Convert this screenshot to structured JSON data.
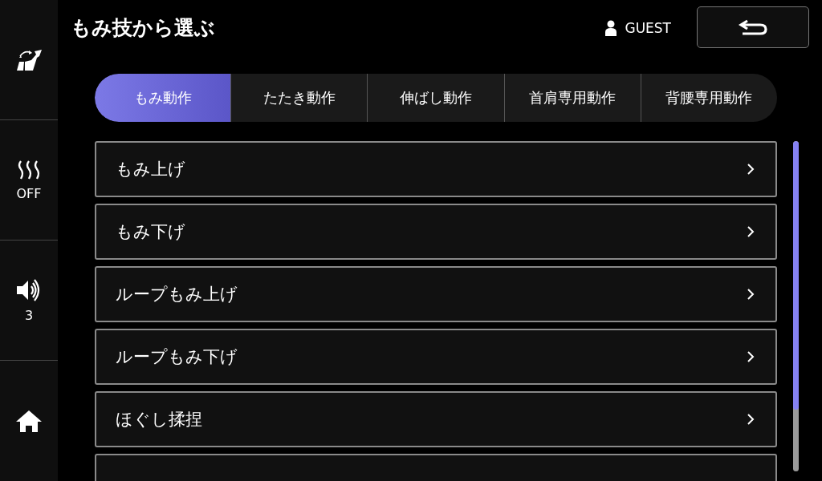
{
  "sidebar": {
    "items": [
      {
        "kind": "seat"
      },
      {
        "kind": "heat",
        "label": "OFF"
      },
      {
        "kind": "volume",
        "label": "3"
      },
      {
        "kind": "home"
      }
    ]
  },
  "header": {
    "title": "もみ技から選ぶ",
    "user": "GUEST"
  },
  "tabs": [
    {
      "label": "もみ動作",
      "selected": true
    },
    {
      "label": "たたき動作",
      "selected": false
    },
    {
      "label": "伸ばし動作",
      "selected": false
    },
    {
      "label": "首肩専用動作",
      "selected": false
    },
    {
      "label": "背腰専用動作",
      "selected": false
    }
  ],
  "items": [
    {
      "label": "もみ上げ"
    },
    {
      "label": "もみ下げ"
    },
    {
      "label": "ループもみ上げ"
    },
    {
      "label": "ループもみ下げ"
    },
    {
      "label": "ほぐし揉捏"
    }
  ],
  "more_below": true
}
